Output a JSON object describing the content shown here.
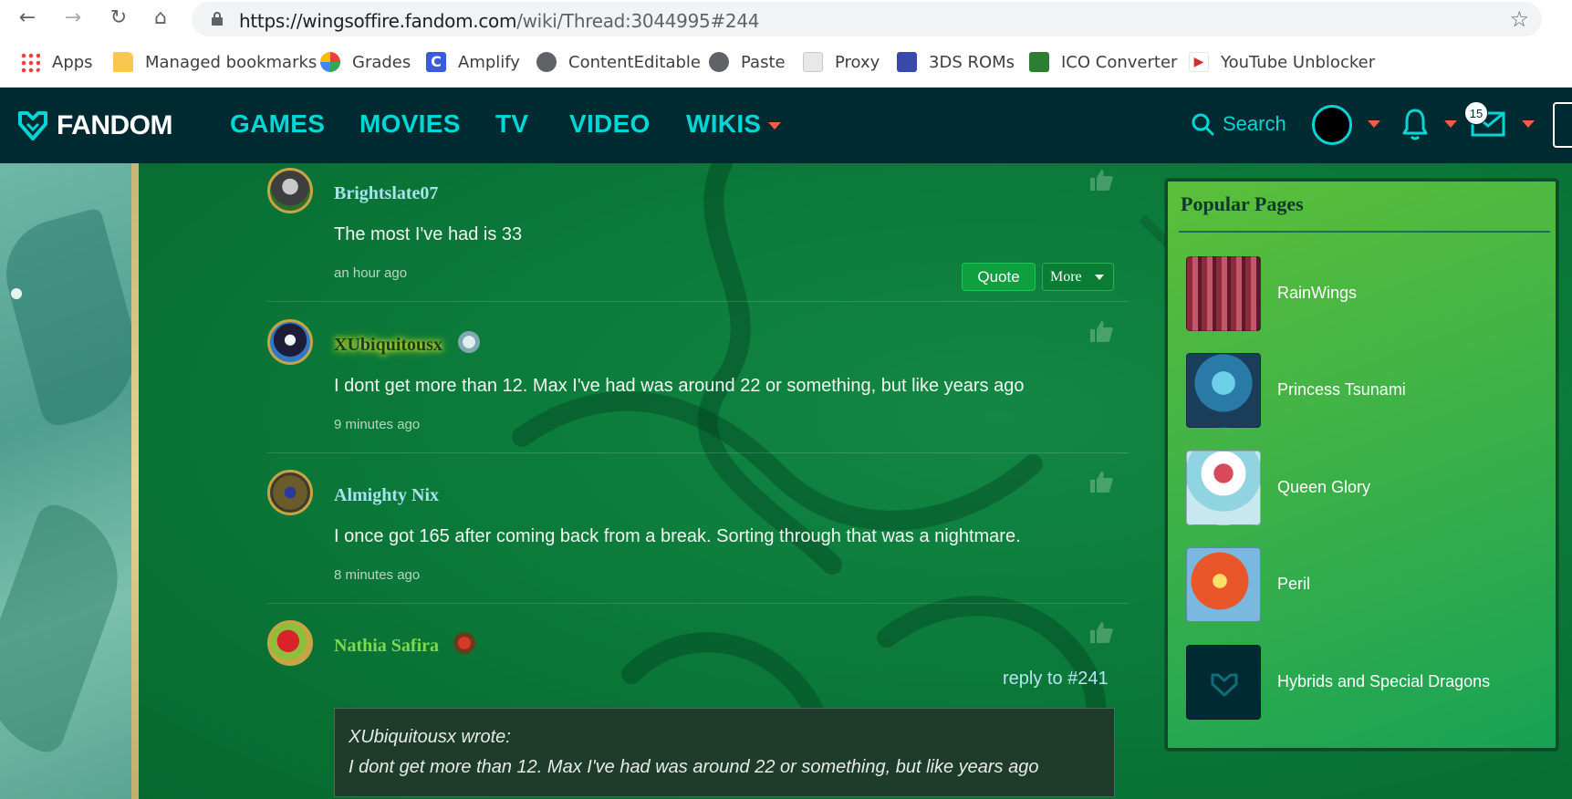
{
  "browser": {
    "url_domain": "https://wingsoffire.fandom.com",
    "url_path": "/wiki/Thread:3044995#244",
    "nav": {
      "back": "←",
      "forward": "→",
      "reload": "↻",
      "home": "⌂",
      "star": "☆"
    },
    "bookmarks": [
      {
        "label": "Apps",
        "icon": "apps-grid-icon"
      },
      {
        "label": "Managed bookmarks",
        "icon": "folder-icon"
      },
      {
        "label": "Grades",
        "icon": "grades-icon"
      },
      {
        "label": "Amplify",
        "icon": "amplify-icon"
      },
      {
        "label": "ContentEditable",
        "icon": "globe-icon"
      },
      {
        "label": "Paste",
        "icon": "globe-icon"
      },
      {
        "label": "Proxy",
        "icon": "proxy-icon"
      },
      {
        "label": "3DS ROMs",
        "icon": "roms-icon"
      },
      {
        "label": "ICO Converter",
        "icon": "ico-converter-icon"
      },
      {
        "label": "YouTube Unblocker",
        "icon": "youtube-icon"
      }
    ]
  },
  "fandom": {
    "logo": "FANDOM",
    "nav": [
      "GAMES",
      "MOVIES",
      "TV",
      "VIDEO",
      "WIKIS"
    ],
    "search_label": "Search",
    "messages_count": "15"
  },
  "comments": [
    {
      "author": "Brightslate07",
      "text": "The most I've had is 33",
      "time": "an hour ago",
      "quote_label": "Quote",
      "more_label": "More"
    },
    {
      "author": "XUbiquitousx",
      "text": "I dont get more than 12. Max I've had was around 22 or something, but like years ago",
      "time": "9 minutes ago"
    },
    {
      "author": "Almighty Nix",
      "text": "I once got 165 after coming back from a break. Sorting through that was a nightmare.",
      "time": "8 minutes ago"
    },
    {
      "author": "Nathia Safira",
      "reply_to": "reply to #241",
      "quote_author": "XUbiquitousx wrote:",
      "quote_text": "I dont get more than 12. Max I've had was around 22 or something, but like years ago"
    }
  ],
  "popular_pages": {
    "title": "Popular Pages",
    "items": [
      "RainWings",
      "Princess Tsunami",
      "Queen Glory",
      "Peril",
      "Hybrids and Special Dragons"
    ]
  },
  "colors": {
    "fandom_bar": "#002a32",
    "nav_accent": "#00d6d6",
    "caret": "#fa5c4a",
    "page_green": "#0b7a3a",
    "rail_green": "#3fb247"
  }
}
